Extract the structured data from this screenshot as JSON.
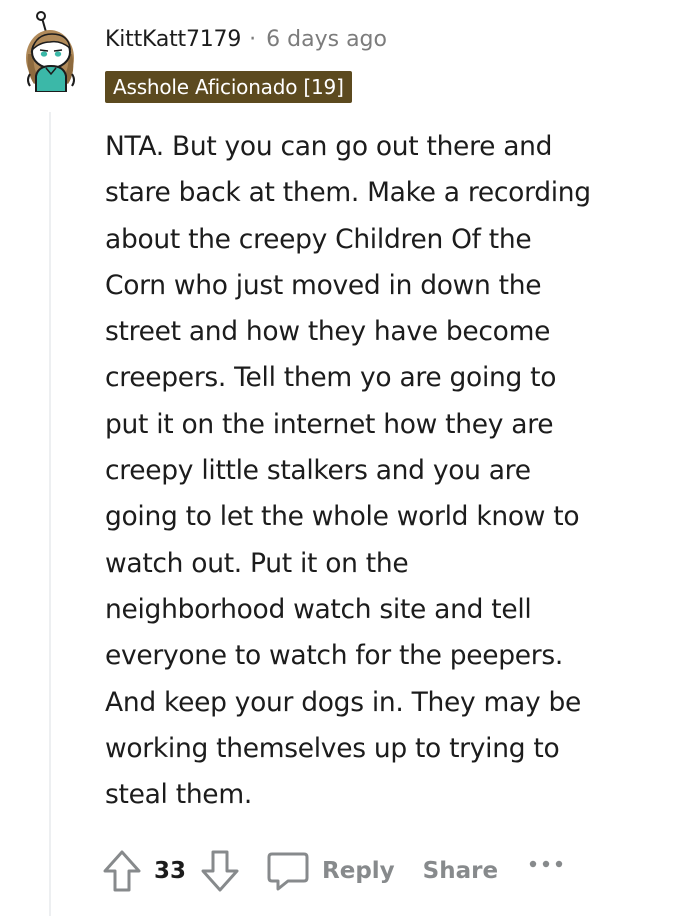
{
  "comment": {
    "username": "KittKatt7179",
    "separator": "·",
    "timestamp": "6 days ago",
    "flair": "Asshole Aficionado [19]",
    "body": "NTA. But you can go out there and stare back at them. Make a recording about the creepy Children Of the Corn who just moved in down the street and how they have become creepers. Tell them yo are going to put it on the internet how they are creepy little stalkers and you are going to let the whole world know to watch out. Put it on the neighborhood watch site and tell everyone to watch for the peepers. And keep your dogs in. They may be working themselves up to trying to steal them.",
    "body_lines": [
      "NTA. But you can go out there and",
      "stare back at them. Make a recording",
      "about the creepy Children Of the",
      "Corn who just moved in down the",
      "street and how they have become",
      "creepers. Tell them yo are going to",
      "put it on the internet how they are",
      "creepy little stalkers and you are",
      "going to let the whole world know to",
      "watch out. Put it on the",
      "neighborhood watch site and tell",
      "everyone to watch for the peepers.",
      "And keep your dogs in. They may be",
      "working themselves up to trying to",
      "steal them."
    ]
  },
  "actions": {
    "vote_count": "33",
    "reply_label": "Reply",
    "share_label": "Share",
    "more_label": "•••"
  },
  "icons": {
    "avatar": "avatar-icon",
    "upvote": "upvote-arrow-icon",
    "downvote": "downvote-arrow-icon",
    "reply": "comment-bubble-icon",
    "more": "more-dots-icon"
  },
  "colors": {
    "flair_bg": "#5c4a1f",
    "avatar_accent": "#3bb8a8",
    "muted": "#878a8c"
  }
}
